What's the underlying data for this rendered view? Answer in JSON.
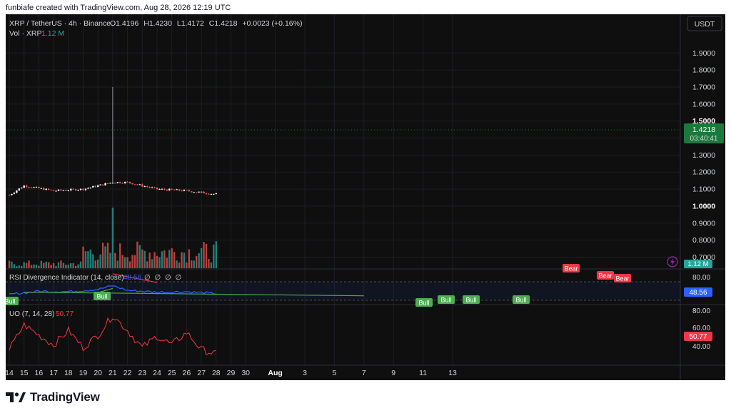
{
  "header": {
    "credit": "funbiafe created with TradingView.com, Aug 28, 2026 12:19 UTC"
  },
  "symbol": {
    "title": "XRP / TetherUS · 4h · Binance",
    "o_label": "O",
    "o_value": "1.4196",
    "h_label": "H",
    "h_value": "1.4230",
    "l_label": "L",
    "l_value": "1.4172",
    "c_label": "C",
    "c_value": "1.4218",
    "change": "+0.0023 (+0.16%)"
  },
  "volume_legend": {
    "label": "Vol · XRP",
    "value": "1.12 M"
  },
  "currency_button": "USDT",
  "price_axis": {
    "ticks": [
      "1.9000",
      "1.8000",
      "1.7000",
      "1.6000",
      "1.5000",
      "1.4000",
      "1.3000",
      "1.2000",
      "1.1000",
      "1.0000",
      "0.9000",
      "0.8000",
      "0.7000"
    ],
    "bold_ticks": [
      "1.5000",
      "1.0000"
    ],
    "last_price": "1.4218",
    "countdown": "03:40:41",
    "volume_tag": "1.12 M"
  },
  "rsi_panel": {
    "title": "RSI Divergence Indicator (14, close)",
    "value": "48.56",
    "na_values": [
      "∅",
      "∅",
      "∅",
      "∅"
    ],
    "axis_tick": "80.00",
    "value_tag": "48.56",
    "bull_label": "Bull",
    "bear_label": "Bear",
    "top_label": "Bear"
  },
  "uo_panel": {
    "title": "UO (7, 14, 28)",
    "value": "50.77",
    "axis_ticks": [
      "80.00",
      "60.00",
      "40.00"
    ],
    "value_tag": "50.77"
  },
  "time_axis": {
    "labels": [
      "14",
      "16",
      "18",
      "20",
      "22",
      "24",
      "26",
      "28",
      "30",
      "Aug",
      "3",
      "5",
      "7",
      "9",
      "11",
      "13",
      "15",
      "17",
      "19",
      "21",
      "23",
      "25",
      "27",
      "29"
    ]
  },
  "colors": {
    "up": "#26a69a",
    "down": "#ef5350",
    "rsi": "#2962ff",
    "uo": "#f23645",
    "background": "#0f0f0f",
    "last_price_tag": "#1b7a3b",
    "bull": "#4caf50",
    "bear": "#f23645"
  },
  "icons": {
    "logo": "tradingview-logo-icon",
    "flash": "lightning-icon"
  },
  "footer": {
    "brand": "TradingView"
  },
  "chart_data": [
    {
      "type": "candlestick",
      "title": "XRP / TetherUS · 4h · Binance",
      "x_labels": [
        "14",
        "16",
        "18",
        "20",
        "22",
        "24",
        "26",
        "28",
        "30",
        "Aug",
        "3",
        "5",
        "7",
        "9",
        "11",
        "13",
        "15",
        "17",
        "19",
        "21",
        "23",
        "25",
        "27",
        "29"
      ],
      "ylim": [
        0.66,
        1.96
      ],
      "keypoints": [
        {
          "x": "14",
          "close": 1.065
        },
        {
          "x": "15",
          "close": 1.12
        },
        {
          "x": "17",
          "close": 1.09
        },
        {
          "x": "19",
          "close": 1.1
        },
        {
          "x": "21",
          "close": 1.14
        },
        {
          "x": "22",
          "close": 1.14
        },
        {
          "x": "24",
          "close": 1.1
        },
        {
          "x": "26",
          "close": 1.09
        },
        {
          "x": "28",
          "close": 1.07
        },
        {
          "x": "30",
          "close": 1.08
        },
        {
          "x": "Aug",
          "close": 1.06
        },
        {
          "x": "3",
          "close": 1.08
        },
        {
          "x": "5",
          "close": 1.06
        },
        {
          "x": "7",
          "close": 1.04
        },
        {
          "x": "9",
          "close": 1.04
        },
        {
          "x": "11",
          "close": 1.01
        },
        {
          "x": "13",
          "close": 1.0
        },
        {
          "x": "15",
          "close": 1.0
        },
        {
          "x": "17",
          "close": 0.995
        },
        {
          "x": "19",
          "close": 1.02
        },
        {
          "x": "20",
          "close": 1.2
        },
        {
          "x": "20.5",
          "close": 1.42
        },
        {
          "x": "21",
          "close": 1.53,
          "high": 1.7
        },
        {
          "x": "22",
          "close": 1.51
        },
        {
          "x": "23",
          "close": 1.52
        },
        {
          "x": "24",
          "close": 1.47
        },
        {
          "x": "25",
          "close": 1.45
        },
        {
          "x": "26",
          "close": 1.42
        },
        {
          "x": "27",
          "close": 1.45
        },
        {
          "x": "28",
          "close": 1.4218
        }
      ]
    },
    {
      "type": "bar",
      "title": "Vol · XRP",
      "note": "volume bars, largest spike near day 21",
      "last": "1.12 M"
    },
    {
      "type": "line",
      "title": "RSI Divergence Indicator (14, close)",
      "last": 48.56,
      "ylim": [
        20,
        90
      ],
      "keypoints": [
        {
          "x": "14",
          "y": 39
        },
        {
          "x": "16",
          "y": 46
        },
        {
          "x": "18",
          "y": 45
        },
        {
          "x": "20",
          "y": 50
        },
        {
          "x": "21",
          "y": 58
        },
        {
          "x": "22",
          "y": 48
        },
        {
          "x": "24",
          "y": 44
        },
        {
          "x": "26",
          "y": 45
        },
        {
          "x": "28",
          "y": 41
        },
        {
          "x": "30",
          "y": 43
        },
        {
          "x": "Aug",
          "y": 47
        },
        {
          "x": "3",
          "y": 44
        },
        {
          "x": "5",
          "y": 43
        },
        {
          "x": "7",
          "y": 38
        },
        {
          "x": "9",
          "y": 40
        },
        {
          "x": "11",
          "y": 42
        },
        {
          "x": "13",
          "y": 47
        },
        {
          "x": "15",
          "y": 44
        },
        {
          "x": "17",
          "y": 47
        },
        {
          "x": "19",
          "y": 50
        },
        {
          "x": "20",
          "y": 81
        },
        {
          "x": "21",
          "y": 84
        },
        {
          "x": "22",
          "y": 80
        },
        {
          "x": "23",
          "y": 64
        },
        {
          "x": "24",
          "y": 63
        },
        {
          "x": "25",
          "y": 58
        },
        {
          "x": "26",
          "y": 50
        },
        {
          "x": "27",
          "y": 54
        },
        {
          "x": "28",
          "y": 48.56
        }
      ]
    },
    {
      "type": "line",
      "title": "UO (7, 14, 28)",
      "last": 50.77,
      "ylim": [
        25,
        85
      ],
      "keypoints": [
        {
          "x": "14",
          "y": 40
        },
        {
          "x": "15",
          "y": 66
        },
        {
          "x": "16",
          "y": 55
        },
        {
          "x": "17",
          "y": 45
        },
        {
          "x": "18",
          "y": 60
        },
        {
          "x": "19",
          "y": 42
        },
        {
          "x": "20",
          "y": 55
        },
        {
          "x": "21",
          "y": 76
        },
        {
          "x": "22",
          "y": 60
        },
        {
          "x": "23",
          "y": 42
        },
        {
          "x": "24",
          "y": 54
        },
        {
          "x": "25",
          "y": 45
        },
        {
          "x": "26",
          "y": 58
        },
        {
          "x": "27",
          "y": 40
        },
        {
          "x": "28",
          "y": 35
        },
        {
          "x": "29",
          "y": 48
        },
        {
          "x": "30",
          "y": 55
        },
        {
          "x": "Aug",
          "y": 58
        },
        {
          "x": "2",
          "y": 45
        },
        {
          "x": "3",
          "y": 56
        },
        {
          "x": "4",
          "y": 38
        },
        {
          "x": "5",
          "y": 62
        },
        {
          "x": "6",
          "y": 55
        },
        {
          "x": "7",
          "y": 45
        },
        {
          "x": "8",
          "y": 42
        },
        {
          "x": "9",
          "y": 52
        },
        {
          "x": "10",
          "y": 45
        },
        {
          "x": "11",
          "y": 40
        },
        {
          "x": "12",
          "y": 48
        },
        {
          "x": "13",
          "y": 55
        },
        {
          "x": "14",
          "y": 50
        },
        {
          "x": "15",
          "y": 45
        },
        {
          "x": "16",
          "y": 58
        },
        {
          "x": "17",
          "y": 66
        },
        {
          "x": "18",
          "y": 50
        },
        {
          "x": "19",
          "y": 40
        },
        {
          "x": "20",
          "y": 70
        },
        {
          "x": "21",
          "y": 79
        },
        {
          "x": "22",
          "y": 64
        },
        {
          "x": "23",
          "y": 52
        },
        {
          "x": "24",
          "y": 48
        },
        {
          "x": "25",
          "y": 53
        },
        {
          "x": "26",
          "y": 50
        },
        {
          "x": "27",
          "y": 45
        },
        {
          "x": "27.5",
          "y": 66
        },
        {
          "x": "28",
          "y": 50.77
        }
      ]
    }
  ]
}
